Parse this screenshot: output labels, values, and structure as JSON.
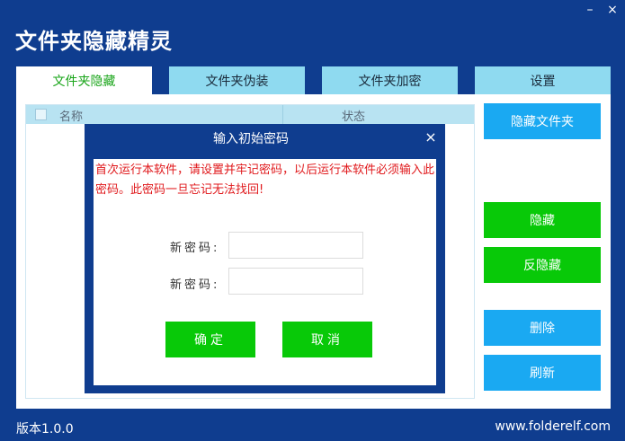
{
  "window": {
    "minimize_glyph": "–",
    "close_glyph": "×"
  },
  "app": {
    "title": "文件夹隐藏精灵"
  },
  "tabs": [
    {
      "label": "文件夹隐藏"
    },
    {
      "label": "文件夹伪装"
    },
    {
      "label": "文件夹加密"
    },
    {
      "label": "设置"
    }
  ],
  "list": {
    "col_name": "名称",
    "col_status": "状态"
  },
  "side_buttons": {
    "hide_folder": "隐藏文件夹",
    "hide": "隐藏",
    "unhide": "反隐藏",
    "delete": "删除",
    "refresh": "刷新"
  },
  "dialog": {
    "title": "输入初始密码",
    "close_glyph": "×",
    "warning": "首次运行本软件，请设置并牢记密码，以后运行本软件必须输入此密码。此密码一旦忘记无法找回!",
    "new_password_label": "新密码:",
    "confirm_password_label": "新密码:",
    "new_password_value": "",
    "confirm_password_value": "",
    "ok_label": "确定",
    "cancel_label": "取消"
  },
  "footer": {
    "version": "版本1.0.0",
    "url": "www.folderelf.com"
  },
  "colors": {
    "frame": "#0f3d8f",
    "tab": "#8fdaf0",
    "active_tab_text": "#1aa51a",
    "blue_button": "#1aa9f2",
    "green_button": "#08c908",
    "warning_text": "#e0191c"
  }
}
